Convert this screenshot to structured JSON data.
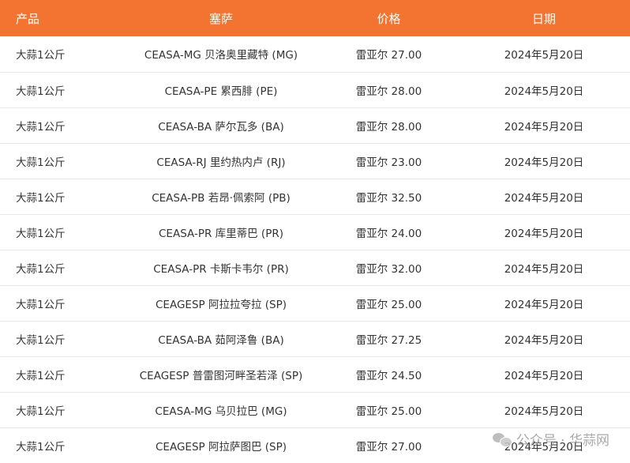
{
  "table": {
    "headers": [
      "产品",
      "塞萨",
      "价格",
      "日期"
    ],
    "rows": [
      {
        "product": "大蒜1公斤",
        "market": "CEASA-MG 贝洛奥里藏特 (MG)",
        "price": "雷亚尔 27.00",
        "date": "2024年5月20日"
      },
      {
        "product": "大蒜1公斤",
        "market": "CEASA-PE 累西腓 (PE)",
        "price": "雷亚尔 28.00",
        "date": "2024年5月20日"
      },
      {
        "product": "大蒜1公斤",
        "market": "CEASA-BA 萨尔瓦多 (BA)",
        "price": "雷亚尔 28.00",
        "date": "2024年5月20日"
      },
      {
        "product": "大蒜1公斤",
        "market": "CEASA-RJ 里约热内卢 (RJ)",
        "price": "雷亚尔 23.00",
        "date": "2024年5月20日"
      },
      {
        "product": "大蒜1公斤",
        "market": "CEASA-PB 若昂·佩索阿 (PB)",
        "price": "雷亚尔 32.50",
        "date": "2024年5月20日"
      },
      {
        "product": "大蒜1公斤",
        "market": "CEASA-PR 库里蒂巴 (PR)",
        "price": "雷亚尔 24.00",
        "date": "2024年5月20日"
      },
      {
        "product": "大蒜1公斤",
        "market": "CEASA-PR 卡斯卡韦尔 (PR)",
        "price": "雷亚尔 32.00",
        "date": "2024年5月20日"
      },
      {
        "product": "大蒜1公斤",
        "market": "CEAGESP 阿拉拉夸拉 (SP)",
        "price": "雷亚尔 25.00",
        "date": "2024年5月20日"
      },
      {
        "product": "大蒜1公斤",
        "market": "CEASA-BA 茹阿泽鲁 (BA)",
        "price": "雷亚尔 27.25",
        "date": "2024年5月20日"
      },
      {
        "product": "大蒜1公斤",
        "market": "CEAGESP 普雷图河畔圣若泽 (SP)",
        "price": "雷亚尔 24.50",
        "date": "2024年5月20日"
      },
      {
        "product": "大蒜1公斤",
        "market": "CEASA-MG 乌贝拉巴 (MG)",
        "price": "雷亚尔 25.00",
        "date": "2024年5月20日"
      },
      {
        "product": "大蒜1公斤",
        "market": "CEAGESP 阿拉萨图巴 (SP)",
        "price": "雷亚尔 27.00",
        "date": "2024年5月20日"
      }
    ]
  },
  "watermark": {
    "text": "公众号 · 华蒜网",
    "icon": "wechat-icon"
  },
  "colors": {
    "header_bg": "#f27430",
    "header_text": "#ffffff",
    "row_border": "#e8e8e8"
  }
}
